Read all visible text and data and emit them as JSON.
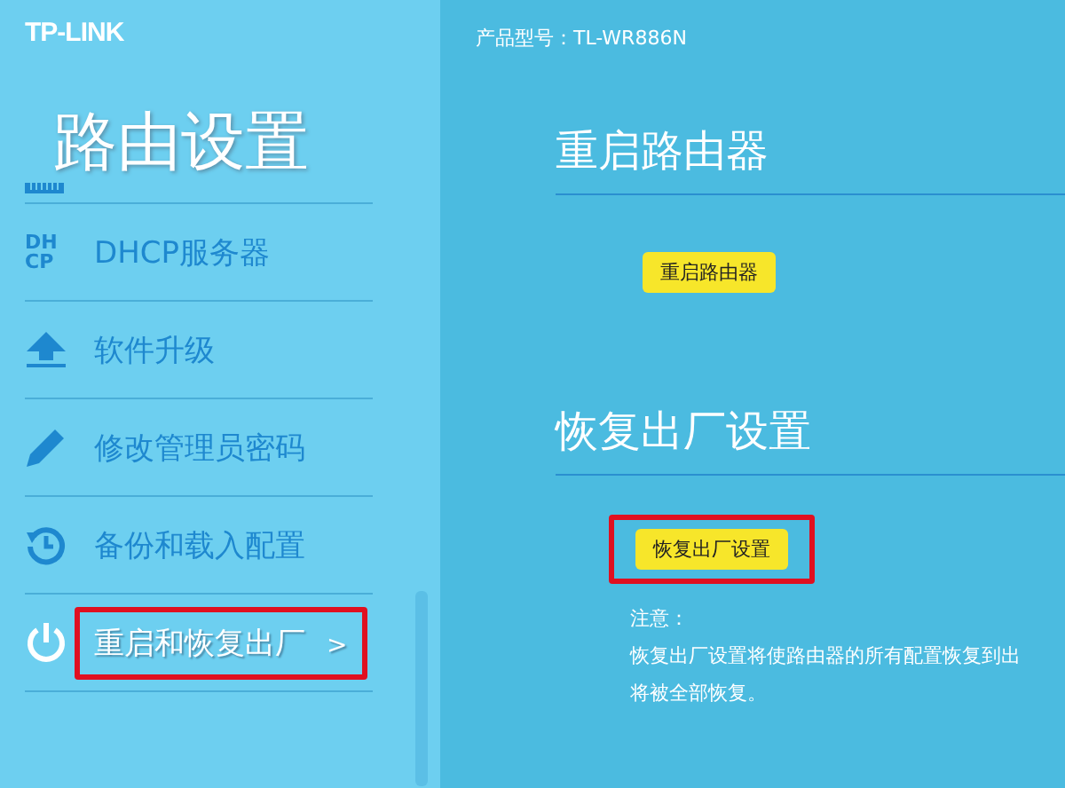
{
  "sidebar": {
    "logo": "TP-LINK",
    "title": "路由设置",
    "partial_item": {
      "kind": "lan"
    },
    "items": [
      {
        "kind": "dhcp",
        "label": "DHCP服务器",
        "icon_text": "DH CP",
        "selected": false,
        "highlighted": false
      },
      {
        "kind": "upgrade",
        "label": "软件升级",
        "selected": false,
        "highlighted": false
      },
      {
        "kind": "password",
        "label": "修改管理员密码",
        "selected": false,
        "highlighted": false
      },
      {
        "kind": "backup",
        "label": "备份和载入配置",
        "selected": false,
        "highlighted": false
      },
      {
        "kind": "power",
        "label": "重启和恢复出厂",
        "arrow": ">",
        "selected": true,
        "highlighted": true
      }
    ]
  },
  "header": {
    "model": "产品型号：TL-WR886N"
  },
  "sections": [
    {
      "title": "重启路由器",
      "button": "重启路由器",
      "highlighted": false
    },
    {
      "title": "恢复出厂设置",
      "button": "恢复出厂设置",
      "highlighted": true,
      "note_title": "注意：",
      "note_lines": [
        "恢复出厂设置将使路由器的所有配置恢复到出",
        "将被全部恢复。"
      ]
    }
  ]
}
